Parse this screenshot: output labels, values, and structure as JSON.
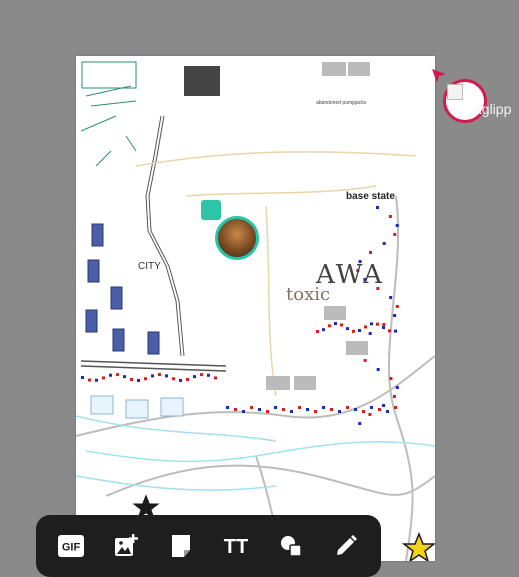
{
  "canvas": {
    "labels": {
      "base_state": "base state",
      "awa": "AWA",
      "toxic": "toxic",
      "city": "CITY",
      "abandoned": "abandoned pumpjacks"
    }
  },
  "remote_user": {
    "name": "aglipp"
  },
  "toolbar": {
    "tools": [
      {
        "icon": "gif-icon",
        "label": "GIF"
      },
      {
        "icon": "image-add-icon"
      },
      {
        "icon": "sticky-note-icon"
      },
      {
        "icon": "text-icon",
        "label": "TT"
      },
      {
        "icon": "shapes-icon"
      },
      {
        "icon": "pencil-icon"
      }
    ]
  },
  "colors": {
    "background": "#8a8a8a",
    "toolbar": "#1e1e1e",
    "local_cursor": "#22c7a9",
    "remote_cursor": "#d3194f"
  }
}
